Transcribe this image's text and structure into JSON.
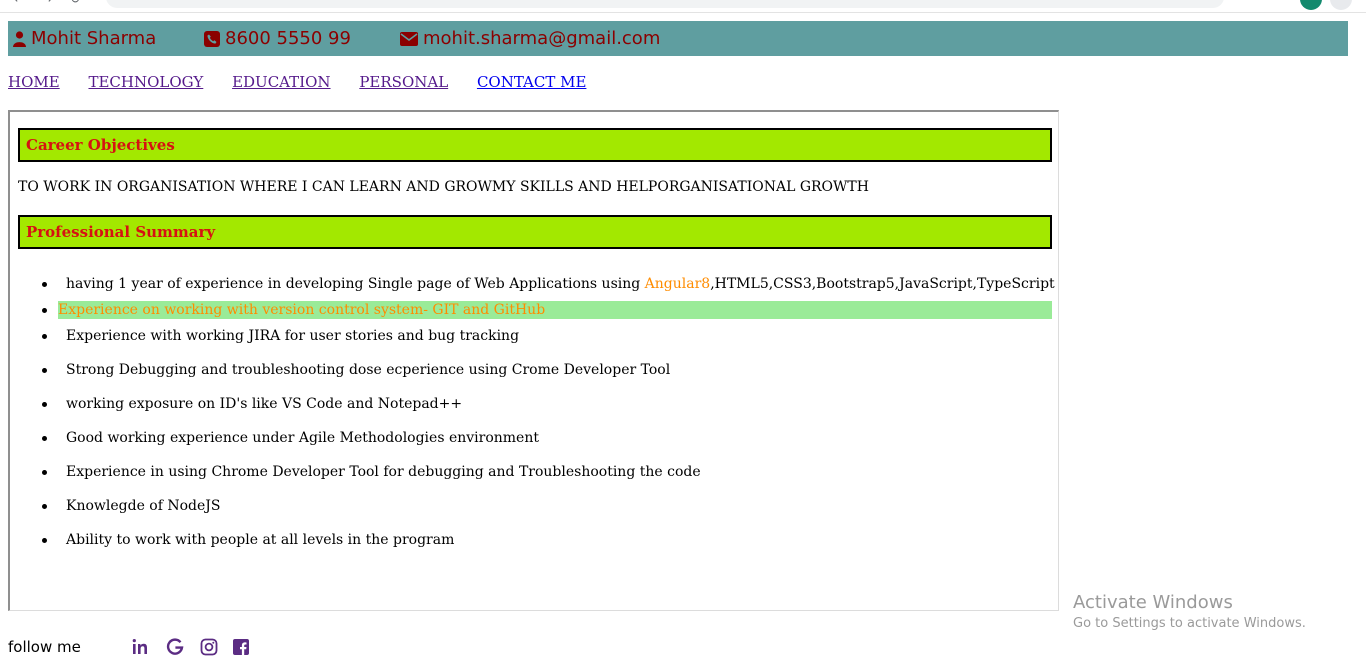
{
  "header": {
    "name": "Mohit Sharma",
    "phone": "8600 5550 99",
    "email": "mohit.sharma@gmail.com"
  },
  "nav": {
    "items": [
      "HOME",
      "TECHNOLOGY",
      "EDUCATION",
      "PERSONAL",
      "CONTACT ME"
    ]
  },
  "career": {
    "heading": "Career Objectives",
    "text": "TO WORK IN ORGANISATION WHERE I CAN LEARN AND GROWMY SKILLS AND HELPORGANISATIONAL GROWTH"
  },
  "summary": {
    "heading": "Professional Summary",
    "first_prefix": "having 1 year of experience in developing Single page of Web Applications using ",
    "first_accent": "Angular8",
    "first_suffix": ",HTML5,CSS3,Bootstrap5,JavaScript,TypeScript",
    "items": [
      "Experience on working with version control system- GIT and GitHub",
      "Experience with working JIRA for user stories and bug tracking",
      "Strong Debugging and troubleshooting dose ecperience using Crome Developer Tool",
      "working exposure on ID's like VS Code and Notepad++",
      "Good working experience under Agile Methodologies environment",
      "Experience in using Chrome Developer Tool for debugging and Troubleshooting the code",
      "Knowlegde of NodeJS",
      "Ability to work with people at all levels in the program"
    ]
  },
  "footer": {
    "follow": "follow me",
    "icons": [
      "linkedin-icon",
      "google-icon",
      "instagram-icon",
      "facebook-icon"
    ]
  },
  "watermark": {
    "line1": "Activate Windows",
    "line2": "Go to Settings to activate Windows."
  },
  "colors": {
    "topbar": "#5f9ea0",
    "header_text": "#8b0000",
    "section_bg": "#a3e800",
    "section_text": "#d61212",
    "accent": "#ff8c00",
    "highlight": "#9aeb98",
    "social": "#5b2c83"
  }
}
